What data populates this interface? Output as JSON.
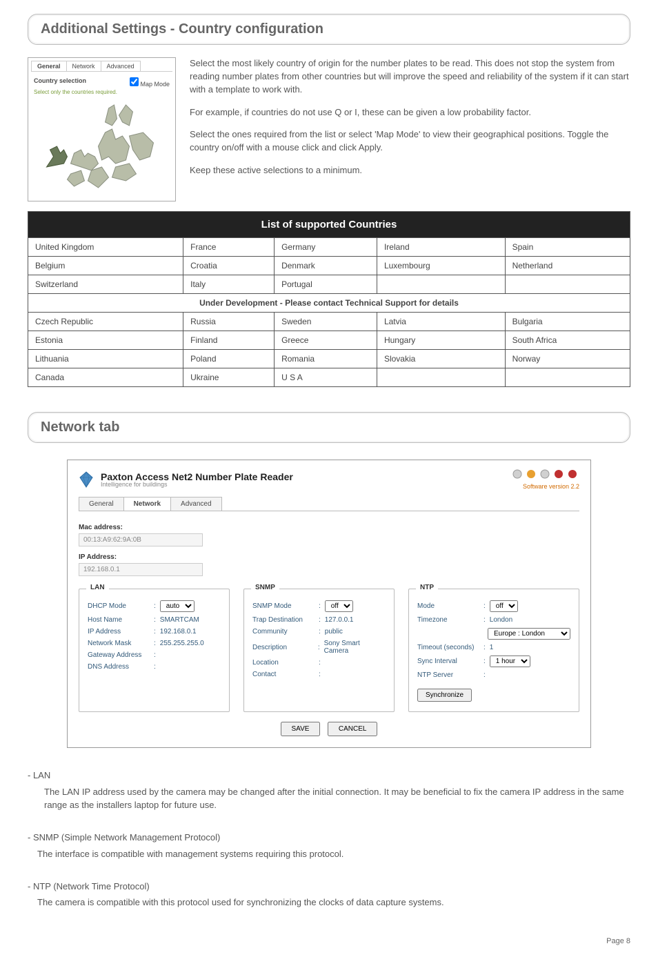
{
  "sections": {
    "country_header": "Additional Settings - Country configuration",
    "network_header": "Network tab"
  },
  "map_panel": {
    "tabs": [
      "General",
      "Network",
      "Advanced"
    ],
    "country_selection_label": "Country selection",
    "map_mode_label": "Map Mode",
    "select_note": "Select only the countries required."
  },
  "paragraphs": {
    "p1": "Select the most likely country of origin for the number plates to be read. This does not stop the system from reading number plates from other countries but will improve the speed and reliability of the system if it can start with a template to work with.",
    "p2": "For example, if countries do not use Q or I, these can be given a low probability factor.",
    "p3": "Select the ones required from the list or select 'Map Mode' to view their geographical positions. Toggle the country on/off with a mouse click and click Apply.",
    "p4": "Keep these active selections to a minimum."
  },
  "table": {
    "title": "List of supported Countries",
    "rows": [
      [
        "United Kingdom",
        "France",
        "Germany",
        "Ireland",
        "Spain"
      ],
      [
        "Belgium",
        "Croatia",
        "Denmark",
        "Luxembourg",
        "Netherland"
      ],
      [
        "Switzerland",
        "Italy",
        "Portugal",
        "",
        ""
      ]
    ],
    "sub_title": "Under Development - Please contact Technical Support for details",
    "rows2": [
      [
        "Czech Republic",
        "Russia",
        "Sweden",
        "Latvia",
        "Bulgaria"
      ],
      [
        "Estonia",
        "Finland",
        "Greece",
        "Hungary",
        "South Africa"
      ],
      [
        "Lithuania",
        "Poland",
        "Romania",
        "Slovakia",
        "Norway"
      ],
      [
        "Canada",
        "Ukraine",
        "U S A",
        "",
        ""
      ]
    ]
  },
  "network_panel": {
    "title": "Paxton Access Net2 Number Plate Reader",
    "subtitle": "Intelligence for buildings",
    "version": "Software version 2.2",
    "tabs": [
      "General",
      "Network",
      "Advanced"
    ],
    "mac_label": "Mac address:",
    "mac_value": "00:13:A9:62:9A:0B",
    "ip_label": "IP Address:",
    "ip_value": "192.168.0.1",
    "lan": {
      "title": "LAN",
      "dhcp_mode_k": "DHCP Mode",
      "dhcp_mode_v": "auto",
      "host_name_k": "Host Name",
      "host_name_v": "SMARTCAM",
      "ip_address_k": "IP Address",
      "ip_address_v": "192.168.0.1",
      "network_mask_k": "Network Mask",
      "network_mask_v": "255.255.255.0",
      "gateway_k": "Gateway Address",
      "gateway_v": "",
      "dns_k": "DNS Address",
      "dns_v": ""
    },
    "snmp": {
      "title": "SNMP",
      "mode_k": "SNMP Mode",
      "mode_v": "off",
      "trap_k": "Trap Destination",
      "trap_v": "127.0.0.1",
      "community_k": "Community",
      "community_v": "public",
      "desc_k": "Description",
      "desc_v": "Sony Smart Camera",
      "loc_k": "Location",
      "loc_v": "",
      "contact_k": "Contact",
      "contact_v": ""
    },
    "ntp": {
      "title": "NTP",
      "mode_k": "Mode",
      "mode_v": "off",
      "tz_k": "Timezone",
      "tz_v": "London",
      "tz2_v": "Europe : London",
      "timeout_k": "Timeout (seconds)",
      "timeout_v": "1",
      "sync_k": "Sync Interval",
      "sync_v": "1 hour",
      "server_k": "NTP Server",
      "server_v": "",
      "sync_btn": "Synchronize"
    },
    "save_btn": "SAVE",
    "cancel_btn": "CANCEL"
  },
  "descriptions": {
    "lan_head": "- LAN",
    "lan_body": "The LAN IP address used by the camera may be changed after the initial connection.   It may be beneficial to fix the camera IP address in the same range as the installers laptop for future use.",
    "snmp_head": "- SNMP  (Simple Network Management Protocol)",
    "snmp_body": "The interface is compatible with management systems requiring this protocol.",
    "ntp_head": "- NTP  (Network Time Protocol)",
    "ntp_body": "The camera is compatible with this protocol used for synchronizing the clocks of data capture systems."
  },
  "page_number": "Page  8"
}
